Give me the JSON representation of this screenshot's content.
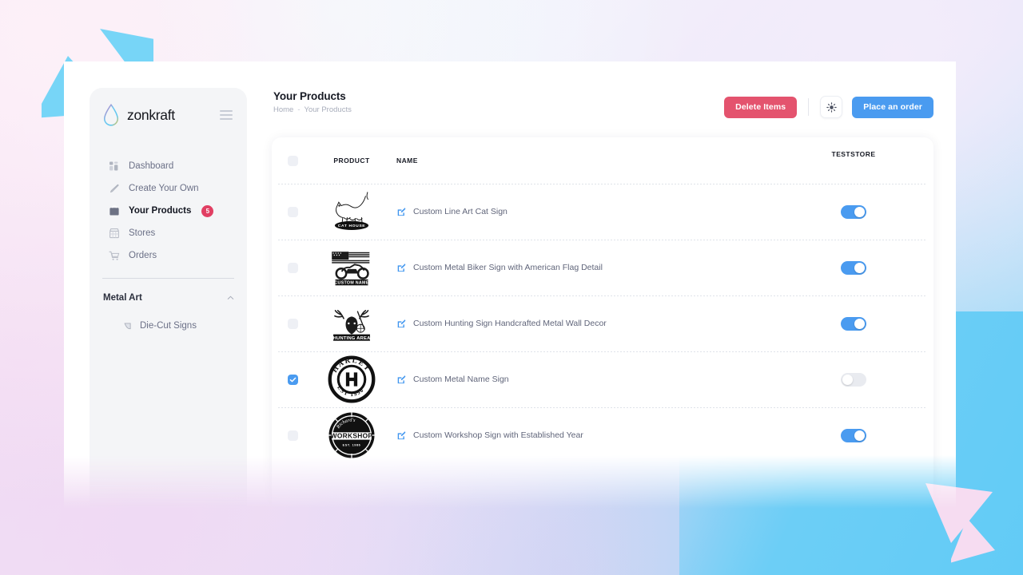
{
  "brand": {
    "name": "zonkraft",
    "logo_icon": "droplet-logo-icon",
    "menu_icon": "hamburger-menu-icon"
  },
  "sidebar": {
    "items": [
      {
        "label": "Dashboard",
        "icon": "dashboard-grid-icon",
        "active": false,
        "badge": ""
      },
      {
        "label": "Create Your Own",
        "icon": "pencil-icon",
        "active": false,
        "badge": ""
      },
      {
        "label": "Your Products",
        "icon": "products-bag-icon",
        "active": true,
        "badge": "5"
      },
      {
        "label": "Stores",
        "icon": "store-icon",
        "active": false,
        "badge": ""
      },
      {
        "label": "Orders",
        "icon": "shopping-cart-icon",
        "active": false,
        "badge": ""
      }
    ],
    "group": {
      "title": "Metal Art",
      "chevron": "chevron-up-icon",
      "items": [
        {
          "label": "Die-Cut Signs",
          "icon": "die-cut-sign-icon"
        }
      ]
    },
    "settings_icon": "gear-icon"
  },
  "header": {
    "title": "Your Products",
    "breadcrumb": {
      "home": "Home",
      "separator": "-",
      "current": "Your Products"
    },
    "delete_label": "Delete Items",
    "theme_icon": "sun-icon",
    "order_label": "Place an order"
  },
  "table": {
    "columns": {
      "product": "PRODUCT",
      "name": "NAME",
      "store": "TESTSTORE"
    },
    "select_all_checked": false,
    "rows": [
      {
        "checked": false,
        "name": "Custom Line Art Cat Sign",
        "thumb": "cat-house-sign-thumb",
        "edit_icon": "edit-pencil-icon",
        "enabled": true
      },
      {
        "checked": false,
        "name": "Custom Metal Biker Sign with American Flag Detail",
        "thumb": "biker-flag-sign-thumb",
        "edit_icon": "edit-pencil-icon",
        "enabled": true
      },
      {
        "checked": false,
        "name": "Custom Hunting Sign Handcrafted Metal Wall Decor",
        "thumb": "hunting-area-sign-thumb",
        "edit_icon": "edit-pencil-icon",
        "enabled": true
      },
      {
        "checked": true,
        "name": "Custom Metal Name Sign",
        "thumb": "harley-circle-sign-thumb",
        "edit_icon": "edit-pencil-icon",
        "enabled": false
      },
      {
        "checked": false,
        "name": "Custom Workshop Sign with Established Year",
        "thumb": "workshop-badge-thumb",
        "edit_icon": "edit-pencil-icon",
        "enabled": true
      }
    ]
  },
  "colors": {
    "accent_blue": "#4a9bf0",
    "danger_red": "#e4536e",
    "badge_red": "#e13f63",
    "sidebar_bg": "#f4f5f7",
    "text_dark": "#171a24",
    "text_muted": "#60657a"
  },
  "decor": {
    "triangle_cyan": "#77d5f7",
    "triangle_pink": "#f6dcf1"
  }
}
